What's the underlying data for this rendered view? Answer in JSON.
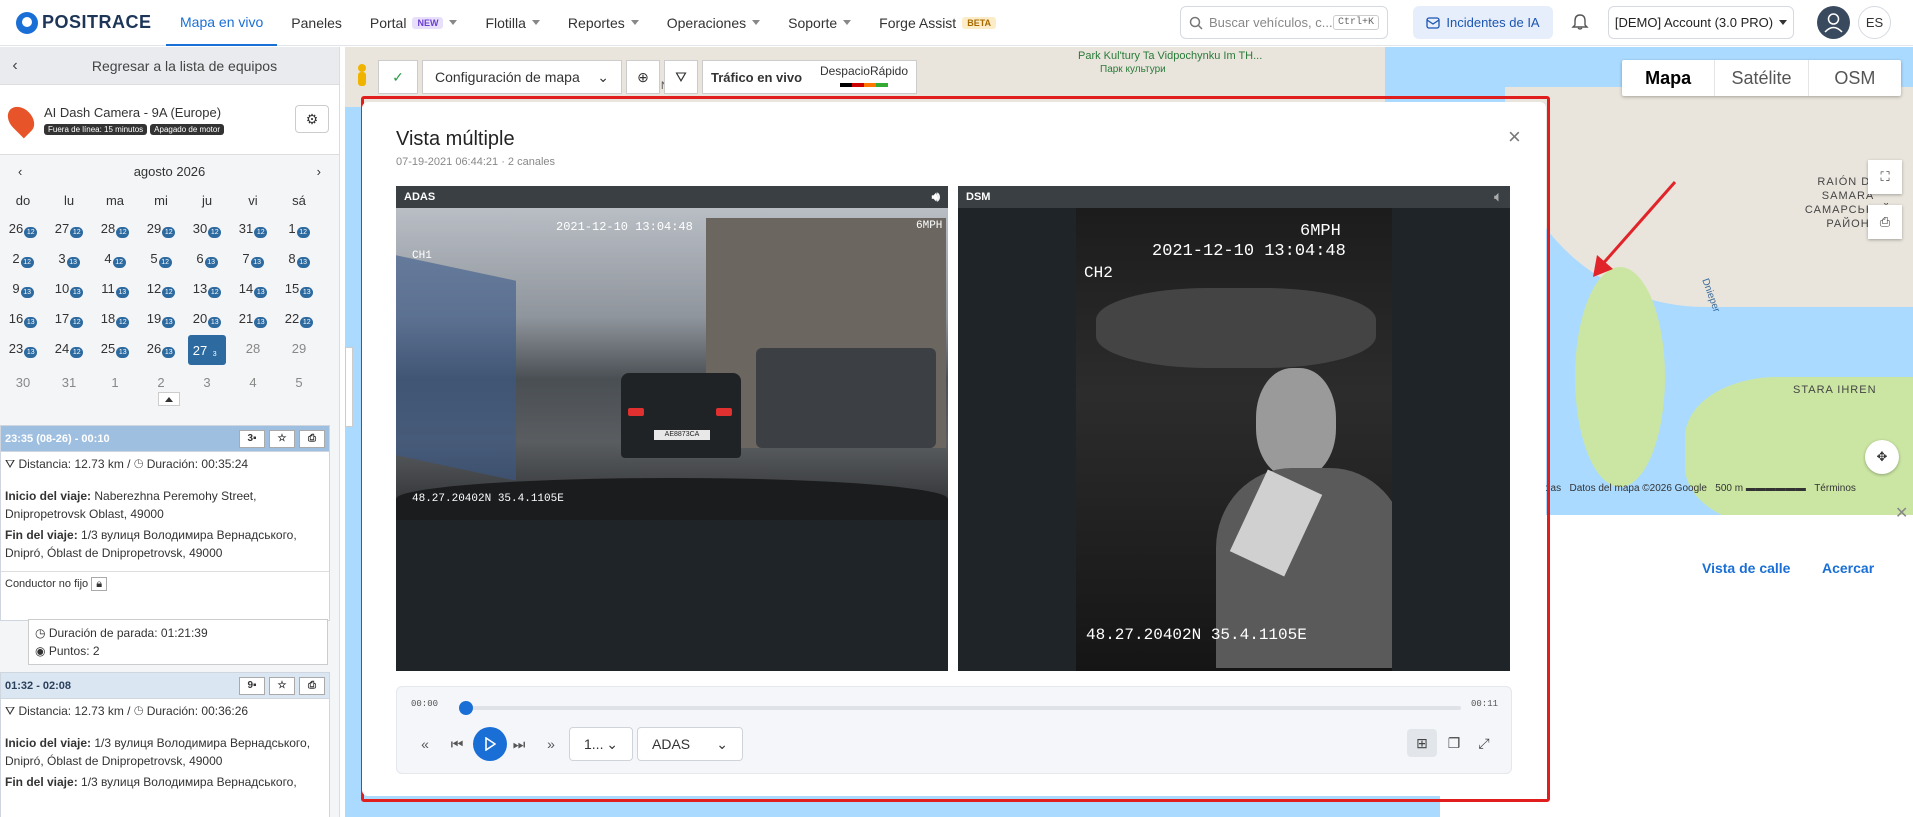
{
  "brand": {
    "name": "POSITRACE"
  },
  "nav": [
    {
      "label": "Mapa en vivo",
      "active": true
    },
    {
      "label": "Paneles"
    },
    {
      "label": "Portal",
      "badge": "NEW",
      "caret": true
    },
    {
      "label": "Flotilla",
      "caret": true
    },
    {
      "label": "Reportes",
      "caret": true
    },
    {
      "label": "Operaciones",
      "caret": true
    },
    {
      "label": "Soporte",
      "caret": true
    },
    {
      "label": "Forge Assist",
      "badge": "BETA"
    }
  ],
  "search": {
    "placeholder": "Buscar vehículos, c...",
    "shortcut": "Ctrl+K"
  },
  "ai_incidents": {
    "label": "Incidentes de IA"
  },
  "account": {
    "label": "[DEMO] Account (3.0 PRO)"
  },
  "lang": {
    "label": "ES"
  },
  "sidebar": {
    "back_label": "Regresar a la lista de equipos",
    "device": {
      "name": "AI Dash Camera - 9A (Europe)",
      "tag1": "Fuera de línea: 15 minutos",
      "tag2": "Apagado de motor"
    },
    "calendar": {
      "month": "agosto 2026",
      "dow": [
        "do",
        "lu",
        "ma",
        "mi",
        "ju",
        "vi",
        "sá"
      ],
      "weeks": [
        [
          [
            "26",
            "12"
          ],
          [
            "27",
            "12"
          ],
          [
            "28",
            "12"
          ],
          [
            "29",
            "12"
          ],
          [
            "30",
            "12"
          ],
          [
            "31",
            "12"
          ],
          [
            "1",
            "12"
          ]
        ],
        [
          [
            "2",
            "12"
          ],
          [
            "3",
            "13"
          ],
          [
            "4",
            "12"
          ],
          [
            "5",
            "12"
          ],
          [
            "6",
            "13"
          ],
          [
            "7",
            "13"
          ],
          [
            "8",
            "13"
          ]
        ],
        [
          [
            "9",
            "13"
          ],
          [
            "10",
            "13"
          ],
          [
            "11",
            "13"
          ],
          [
            "12",
            "12"
          ],
          [
            "13",
            "12"
          ],
          [
            "14",
            "13"
          ],
          [
            "15",
            "13"
          ]
        ],
        [
          [
            "16",
            "13"
          ],
          [
            "17",
            "12"
          ],
          [
            "18",
            "12"
          ],
          [
            "19",
            "13"
          ],
          [
            "20",
            "13"
          ],
          [
            "21",
            "13"
          ],
          [
            "22",
            "12"
          ]
        ],
        [
          [
            "23",
            "13"
          ],
          [
            "24",
            "12"
          ],
          [
            "25",
            "13"
          ],
          [
            "26",
            "13"
          ],
          [
            "27",
            "3"
          ],
          [
            "28",
            ""
          ],
          [
            "29",
            ""
          ]
        ],
        [
          [
            "30",
            ""
          ],
          [
            "31",
            ""
          ],
          [
            "1",
            ""
          ],
          [
            "2",
            ""
          ],
          [
            "3",
            ""
          ],
          [
            "4",
            ""
          ],
          [
            "5",
            ""
          ]
        ]
      ]
    },
    "trips": [
      {
        "header": "23:35 (08-26) - 00:10",
        "cam_count": "3",
        "distance_label": "Distancia:",
        "distance": "12.73 km",
        "duration_label": "Duración:",
        "duration": "00:35:24",
        "start_label": "Inicio del viaje:",
        "start": "Naberezhna Peremohy Street, Dnipropetrovsk Oblast, 49000",
        "end_label": "Fin del viaje:",
        "end": "1/3 вулиця Володимира Вернадського, Dnipró, Óblast de Dnipropetrovsk, 49000",
        "driver": "Conductor no fijo"
      },
      {
        "header": "01:32 - 02:08",
        "cam_count": "9",
        "distance_label": "Distancia:",
        "distance": "12.73 km",
        "duration_label": "Duración:",
        "duration": "00:36:26",
        "start_label": "Inicio del viaje:",
        "start": "1/3 вулиця Володимира Вернадського, Dnipró, Óblast de Dnipropetrovsk, 49000",
        "end_label": "Fin del viaje:",
        "end": "1/3 вулиця Володимира Вернадського,"
      }
    ],
    "stop": {
      "duration_label": "Duración de parada:",
      "duration": "01:21:39",
      "points_label": "Puntos:",
      "points": "2"
    }
  },
  "map": {
    "types": [
      "Mapa",
      "Satélite",
      "OSM"
    ],
    "toolbar": {
      "config": "Configuración de mapa",
      "traffic": "Tráfico en vivo",
      "mode1": "Despacio",
      "mode2": "Rápido"
    },
    "labels": {
      "park": "Park Kul'tury Ta Vidpochynku Im TH...",
      "park_uk": "Парк культури",
      "raion": "RAION DE",
      "samara": "RAIÓN DE SAMARA",
      "samara_uk": "САМАРСЬКИЙ РАЙОН",
      "river": "Dnieper",
      "stara": "STARA IHREN",
      "keys": "teclas",
      "mapdata": "Datos del mapa ©2026 Google",
      "scale": "500 m",
      "terms": "Términos"
    },
    "panel_links": {
      "street_view": "Vista de calle",
      "zoom": "Acercar"
    }
  },
  "modal": {
    "title": "Vista múltiple",
    "subtitle": "07-19-2021 06:44:21 · 2 canales",
    "channels": [
      {
        "name": "ADAS",
        "ts": "2021-12-10 13:04:48",
        "speed": "6MPH",
        "ch": "CH1",
        "gps": "48.27.20402N 35.4.1105E",
        "plate": "AE8873CA"
      },
      {
        "name": "DSM",
        "ts": "2021-12-10 13:04:48",
        "speed": "6MPH",
        "ch": "CH2",
        "gps": "48.27.20402N 35.4.1105E"
      }
    ],
    "player": {
      "current": "00:00",
      "total": "00:11",
      "progress": 0,
      "speed_label": "1...",
      "channel_select": "ADAS"
    }
  }
}
